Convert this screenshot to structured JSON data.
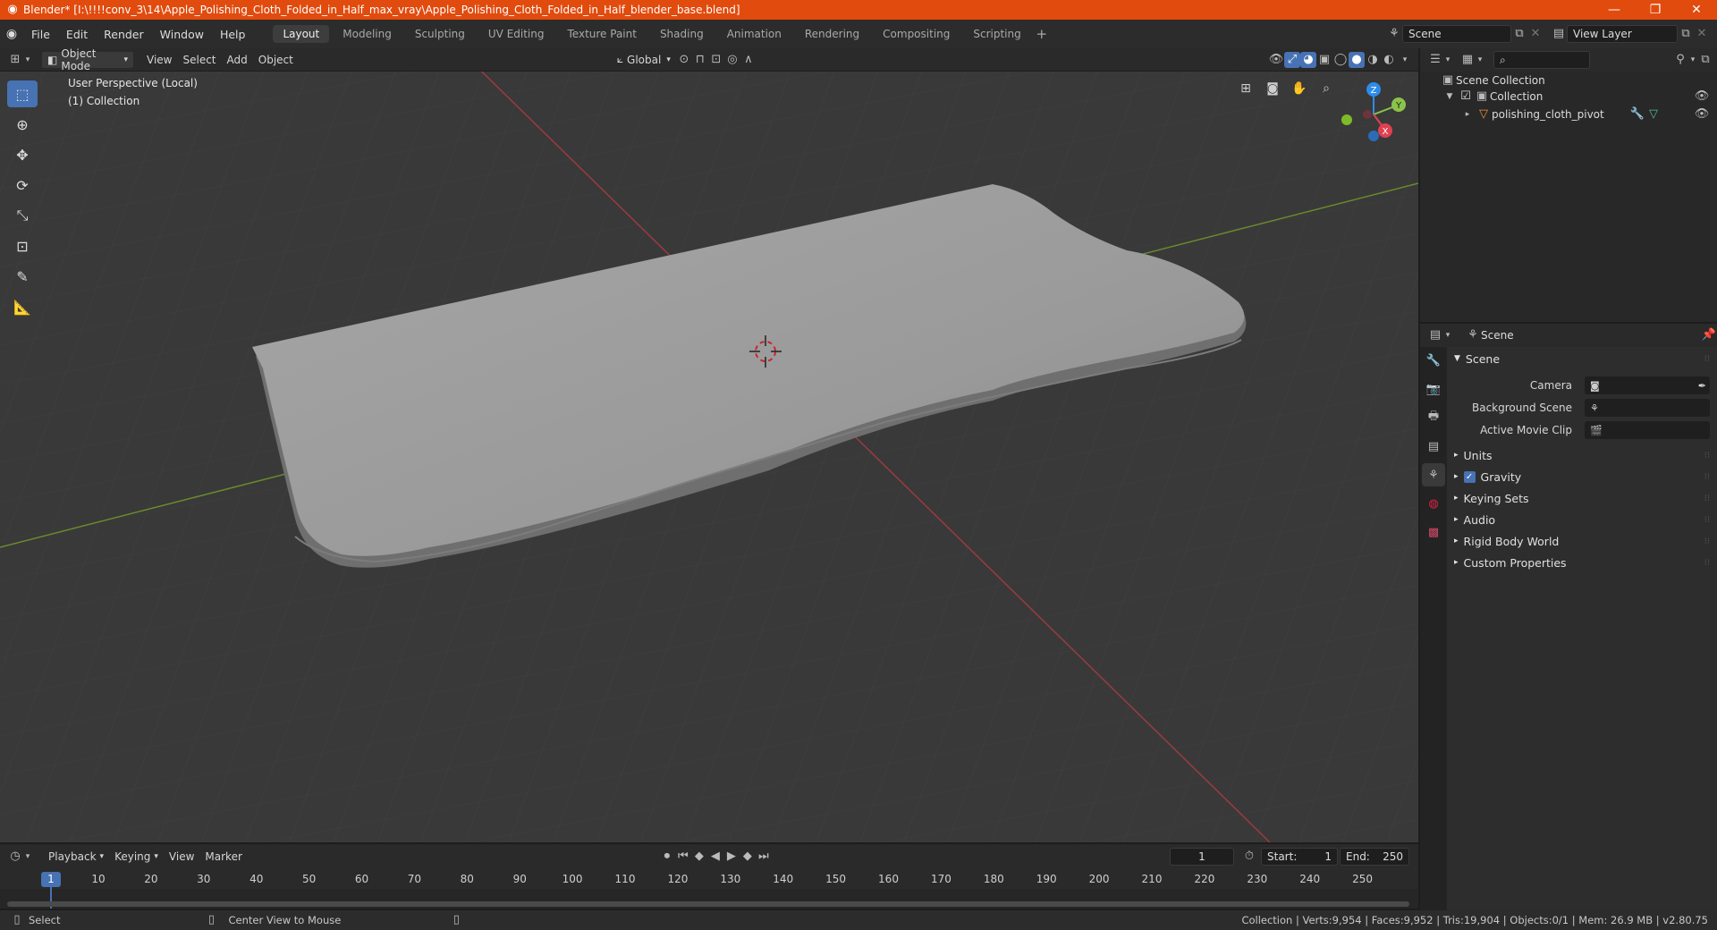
{
  "window": {
    "title": "Blender* [I:\\!!!!conv_3\\14\\Apple_Polishing_Cloth_Folded_in_Half_max_vray\\Apple_Polishing_Cloth_Folded_in_Half_blender_base.blend]",
    "minimize": "—",
    "maximize": "❐",
    "close": "✕"
  },
  "menu": [
    "File",
    "Edit",
    "Render",
    "Window",
    "Help"
  ],
  "workspaces": [
    "Layout",
    "Modeling",
    "Sculpting",
    "UV Editing",
    "Texture Paint",
    "Shading",
    "Animation",
    "Rendering",
    "Compositing",
    "Scripting"
  ],
  "active_workspace": "Layout",
  "scene_selector": "Scene",
  "view_layer_selector": "View Layer",
  "viewport_header": {
    "mode": "Object Mode",
    "menus": [
      "View",
      "Select",
      "Add",
      "Object"
    ],
    "transform_orientation": "Global"
  },
  "viewport": {
    "perspective_label": "User Perspective (Local)",
    "collection_label": "(1) Collection"
  },
  "gizmo": {
    "x": "X",
    "y": "Y",
    "z": "Z"
  },
  "outliner": {
    "root": "Scene Collection",
    "collection": "Collection",
    "object": "polishing_cloth_pivot"
  },
  "properties": {
    "context": "Scene",
    "panel_scene": "Scene",
    "camera_label": "Camera",
    "background_scene_label": "Background Scene",
    "active_movie_clip_label": "Active Movie Clip",
    "collapsed_panels": [
      "Units",
      "Gravity",
      "Keying Sets",
      "Audio",
      "Rigid Body World",
      "Custom Properties"
    ],
    "gravity_checked": true
  },
  "timeline_header": {
    "menus": [
      "Playback",
      "Keying",
      "View",
      "Marker"
    ],
    "current_frame": "1",
    "start_label": "Start:",
    "start_value": "1",
    "end_label": "End:",
    "end_value": "250"
  },
  "timeline": {
    "current_frame_badge": "1",
    "frame_labels": [
      "10",
      "20",
      "30",
      "40",
      "50",
      "60",
      "70",
      "80",
      "90",
      "100",
      "110",
      "120",
      "130",
      "140",
      "150",
      "160",
      "170",
      "180",
      "190",
      "200",
      "210",
      "220",
      "230",
      "240",
      "250"
    ]
  },
  "statusbar": {
    "left_action": "Select",
    "middle_action": "Center View to Mouse",
    "stats": "Collection | Verts:9,954 | Faces:9,952 | Tris:19,904 | Objects:0/1 | Mem: 26.9 MB | v2.80.75"
  },
  "colors": {
    "title_bar": "#e14b0e",
    "accent_blue": "#4772b3",
    "axis_x_red": "#e0414f",
    "axis_y_green": "#8bc34a",
    "axis_z_blue": "#2d8ceb"
  }
}
